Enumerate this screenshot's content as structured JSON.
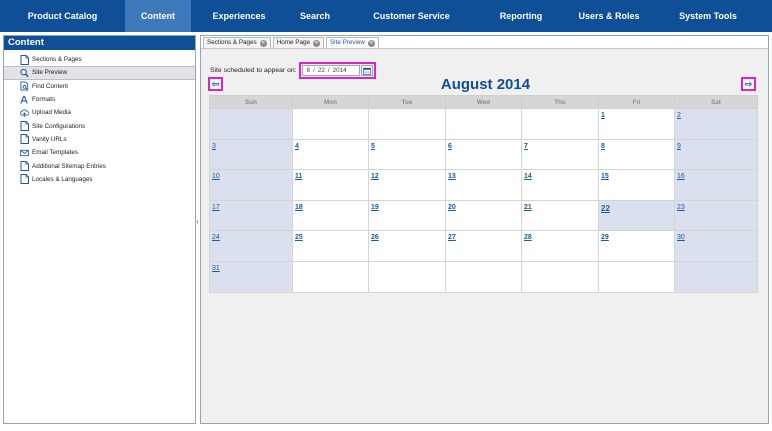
{
  "topnav": {
    "items": [
      {
        "label": "Product Catalog",
        "active": false
      },
      {
        "label": "Content",
        "active": true
      },
      {
        "label": "Experiences",
        "active": false
      },
      {
        "label": "Search",
        "active": false
      },
      {
        "label": "Customer Service",
        "active": false
      },
      {
        "label": "Reporting",
        "active": false
      },
      {
        "label": "Users & Roles",
        "active": false
      },
      {
        "label": "System Tools",
        "active": false
      }
    ]
  },
  "sidebar": {
    "title": "Content",
    "items": [
      {
        "label": "Sections & Pages",
        "icon": "page-icon",
        "active": false
      },
      {
        "label": "Site Preview",
        "icon": "magnifier-icon",
        "active": true
      },
      {
        "label": "Find Content",
        "icon": "find-page-icon",
        "active": false
      },
      {
        "label": "Formats",
        "icon": "font-icon",
        "active": false
      },
      {
        "label": "Upload Media",
        "icon": "upload-icon",
        "active": false
      },
      {
        "label": "Site Configurations",
        "icon": "page-icon",
        "active": false
      },
      {
        "label": "Vanity URLs",
        "icon": "page-icon",
        "active": false
      },
      {
        "label": "Email Templates",
        "icon": "envelope-icon",
        "active": false
      },
      {
        "label": "Additional Sitemap Entries",
        "icon": "page-icon",
        "active": false
      },
      {
        "label": "Locales & Languages",
        "icon": "page-icon",
        "active": false
      }
    ]
  },
  "tabs": [
    {
      "label": "Sections & Pages",
      "active": false
    },
    {
      "label": "Home Page",
      "active": false
    },
    {
      "label": "Site Preview",
      "active": true
    }
  ],
  "schedule": {
    "label": "Site scheduled to appear on:",
    "month": "8",
    "day": "22",
    "year": "2014",
    "sep": "/"
  },
  "calendar": {
    "title": "August 2014",
    "prev_label": "⇦",
    "next_label": "⇨",
    "weekdays": [
      "Sun",
      "Mon",
      "Tue",
      "Wed",
      "Thu",
      "Fri",
      "Sat"
    ],
    "weeks": [
      [
        "",
        "",
        "",
        "",
        "",
        "1",
        "2"
      ],
      [
        "3",
        "4",
        "5",
        "6",
        "7",
        "8",
        "9"
      ],
      [
        "10",
        "11",
        "12",
        "13",
        "14",
        "15",
        "16"
      ],
      [
        "17",
        "18",
        "19",
        "20",
        "21",
        "22",
        "23"
      ],
      [
        "24",
        "25",
        "26",
        "27",
        "28",
        "29",
        "30"
      ],
      [
        "31",
        "",
        "",
        "",
        "",
        "",
        ""
      ]
    ],
    "selected_day": "22"
  },
  "colors": {
    "nav_bg": "#0f4f97",
    "nav_active": "#3e79bb",
    "highlight": "#e020c8",
    "weekend_bg": "#dbe0ef",
    "link": "#1c5aa2"
  }
}
